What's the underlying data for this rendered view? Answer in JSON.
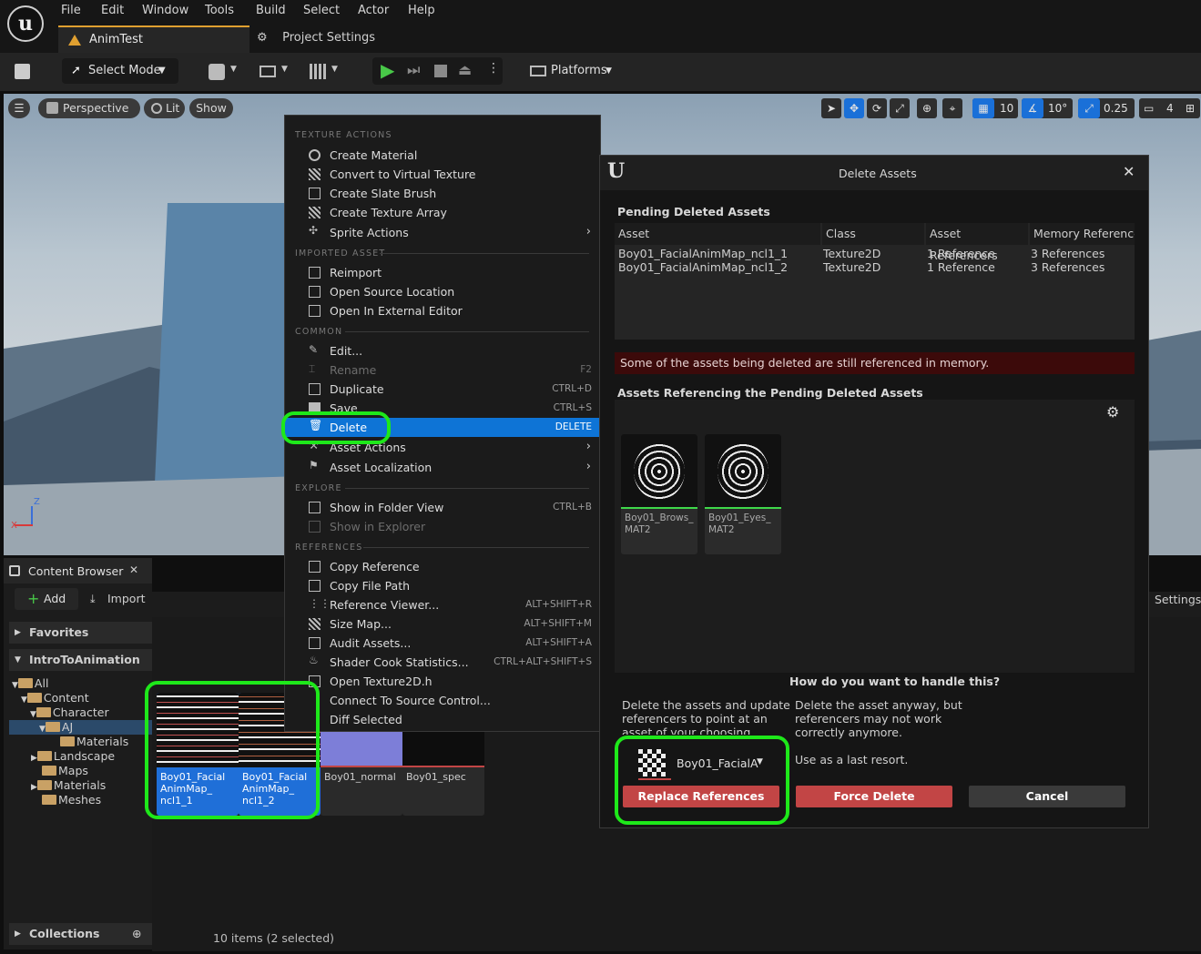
{
  "menu": {
    "logo": "u",
    "items": [
      "File",
      "Edit",
      "Window",
      "Tools",
      "Build",
      "Select",
      "Actor",
      "Help"
    ]
  },
  "tabs": {
    "active": "AnimTest",
    "other": "Project Settings"
  },
  "toolbar": {
    "select_mode": "Select Mode",
    "platforms": "Platforms"
  },
  "viewport": {
    "perspective": "Perspective",
    "lit": "Lit",
    "show": "Show",
    "grid": "10",
    "angle": "10°",
    "scale": "0.25",
    "camera": "4",
    "axis_x": "X",
    "axis_z": "Z"
  },
  "content_browser": {
    "tab": "Content Browser",
    "add": "Add",
    "import": "Import",
    "favorites": "Favorites",
    "project": "IntroToAnimation",
    "tree": [
      "All",
      "Content",
      "Character",
      "AJ",
      "Materials",
      "Landscape",
      "Maps",
      "Materials",
      "Meshes"
    ],
    "collections": "Collections",
    "status": "10 items (2 selected)",
    "settings": "Settings",
    "assets": [
      {
        "line1": "Boy01_Facial",
        "line2": "AnimMap_",
        "line3": "ncl1_1"
      },
      {
        "line1": "Boy01_Facial",
        "line2": "AnimMap_",
        "line3": "ncl1_2"
      },
      {
        "line1": "Boy01_normal"
      },
      {
        "line1": "Boy01_spec"
      }
    ]
  },
  "context_menu": {
    "headers": [
      "TEXTURE ACTIONS",
      "IMPORTED ASSET",
      "COMMON",
      "EXPLORE",
      "REFERENCES"
    ],
    "items": [
      {
        "label": "Create Material",
        "shortcut": ""
      },
      {
        "label": "Convert to Virtual Texture",
        "shortcut": ""
      },
      {
        "label": "Create Slate Brush",
        "shortcut": ""
      },
      {
        "label": "Create Texture Array",
        "shortcut": ""
      },
      {
        "label": "Sprite Actions",
        "shortcut": ""
      },
      {
        "label": "Reimport",
        "shortcut": ""
      },
      {
        "label": "Open Source Location",
        "shortcut": ""
      },
      {
        "label": "Open In External Editor",
        "shortcut": ""
      },
      {
        "label": "Edit...",
        "shortcut": ""
      },
      {
        "label": "Rename",
        "shortcut": "F2"
      },
      {
        "label": "Duplicate",
        "shortcut": "CTRL+D"
      },
      {
        "label": "Save",
        "shortcut": "CTRL+S"
      },
      {
        "label": "Delete",
        "shortcut": "DELETE"
      },
      {
        "label": "Asset Actions",
        "shortcut": ""
      },
      {
        "label": "Asset Localization",
        "shortcut": ""
      },
      {
        "label": "Show in Folder View",
        "shortcut": "CTRL+B"
      },
      {
        "label": "Show in Explorer",
        "shortcut": ""
      },
      {
        "label": "Copy Reference",
        "shortcut": ""
      },
      {
        "label": "Copy File Path",
        "shortcut": ""
      },
      {
        "label": "Reference Viewer...",
        "shortcut": "ALT+SHIFT+R"
      },
      {
        "label": "Size Map...",
        "shortcut": "ALT+SHIFT+M"
      },
      {
        "label": "Audit Assets...",
        "shortcut": "ALT+SHIFT+A"
      },
      {
        "label": "Shader Cook Statistics...",
        "shortcut": "CTRL+ALT+SHIFT+S"
      },
      {
        "label": "Open Texture2D.h",
        "shortcut": ""
      },
      {
        "label": "Connect To Source Control...",
        "shortcut": ""
      },
      {
        "label": "Diff Selected",
        "shortcut": ""
      }
    ]
  },
  "dialog": {
    "title": "Delete Assets",
    "pending_title": "Pending Deleted Assets",
    "columns": [
      "Asset",
      "Class",
      "Asset Referencers",
      "Memory Reference"
    ],
    "rows": [
      {
        "asset": "Boy01_FacialAnimMap_ncl1_1",
        "class": "Texture2D",
        "referencers": "1 Reference",
        "memory": "3 References"
      },
      {
        "asset": "Boy01_FacialAnimMap_ncl1_2",
        "class": "Texture2D",
        "referencers": "1 Reference",
        "memory": "3 References"
      }
    ],
    "warning": "Some of the assets being deleted are still referenced in memory.",
    "referencing_title": "Assets Referencing the Pending Deleted Assets",
    "ref_assets": [
      {
        "line1": "Boy01_Brows_",
        "line2": "MAT2"
      },
      {
        "line1": "Boy01_Eyes_",
        "line2": "MAT2"
      }
    ],
    "question": "How do you want to handle this?",
    "replace_desc": [
      "Delete the assets and update",
      "referencers to point at an",
      "asset of your choosing."
    ],
    "force_desc": [
      "Delete the asset anyway, but",
      "referencers may not work",
      "correctly anymore."
    ],
    "last_resort": "Use as a last resort.",
    "picker_value": "Boy01_FacialA",
    "replace_btn": "Replace References",
    "force_btn": "Force Delete",
    "cancel_btn": "Cancel"
  },
  "colors": {
    "highlight": "#0e74d6",
    "annotation": "#1ee81a",
    "danger": "#c24545",
    "warning_bg": "#3c0a0a"
  }
}
